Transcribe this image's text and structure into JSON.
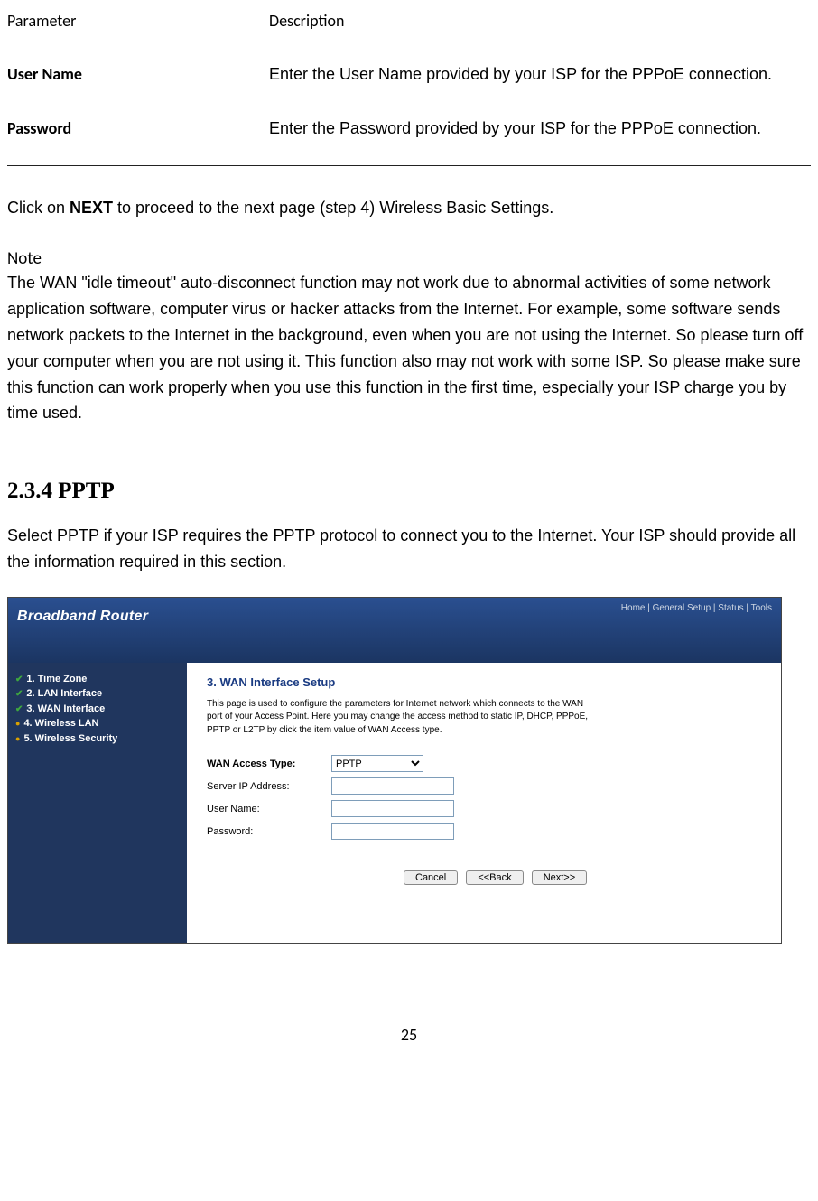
{
  "table": {
    "header_param": "Parameter",
    "header_desc": "Description",
    "rows": [
      {
        "param": "User Name",
        "desc": "Enter the User Name provided by your ISP for the PPPoE connection."
      },
      {
        "param": "Password",
        "desc": "Enter the Password provided by your ISP for the PPPoE connection."
      }
    ]
  },
  "click_next_pre": "Click on ",
  "click_next_bold": "NEXT",
  "click_next_post": " to proceed to the next page (step 4) Wireless Basic Settings.",
  "note_heading": "Note",
  "note_body": "The WAN  \"idle timeout\" auto-disconnect function may not work due to abnormal activities of some network application software, computer virus or hacker attacks from the Internet. For example, some software sends network packets to the Internet in the background, even when you are not using the Internet. So please turn off your computer when you are not using it. This function also may not work with some ISP. So please make sure this function can work properly when you use this function in the first time, especially your ISP charge you by time used.",
  "section_heading": "2.3.4 PPTP",
  "section_intro": "Select PPTP if your ISP requires the PPTP protocol to connect you to the Internet. Your ISP should provide all the information required in this section.",
  "router": {
    "title": "Broadband Router",
    "top_links": [
      "Home",
      "General Setup",
      "Status",
      "Tools"
    ],
    "sidebar": [
      {
        "mark": "tick",
        "text": "1. Time Zone"
      },
      {
        "mark": "tick",
        "text": "2. LAN Interface"
      },
      {
        "mark": "tick",
        "text": "3. WAN Interface"
      },
      {
        "mark": "bullet",
        "text": "4. Wireless LAN"
      },
      {
        "mark": "bullet",
        "text": "5. Wireless Security"
      }
    ],
    "main_title": "3. WAN Interface Setup",
    "main_desc": "This page is used to configure the parameters for Internet network which connects to the WAN port of your Access Point. Here you may change the access method to static IP, DHCP, PPPoE, PPTP or L2TP by click the item value of WAN Access type.",
    "fields": {
      "wan_access_label": "WAN Access Type:",
      "wan_access_value": "PPTP",
      "server_ip_label": "Server IP Address:",
      "server_ip_value": "",
      "user_name_label": "User Name:",
      "user_name_value": "",
      "password_label": "Password:",
      "password_value": ""
    },
    "buttons": {
      "cancel": "Cancel",
      "back": "<<Back",
      "next": "Next>>"
    }
  },
  "page_number": "25"
}
